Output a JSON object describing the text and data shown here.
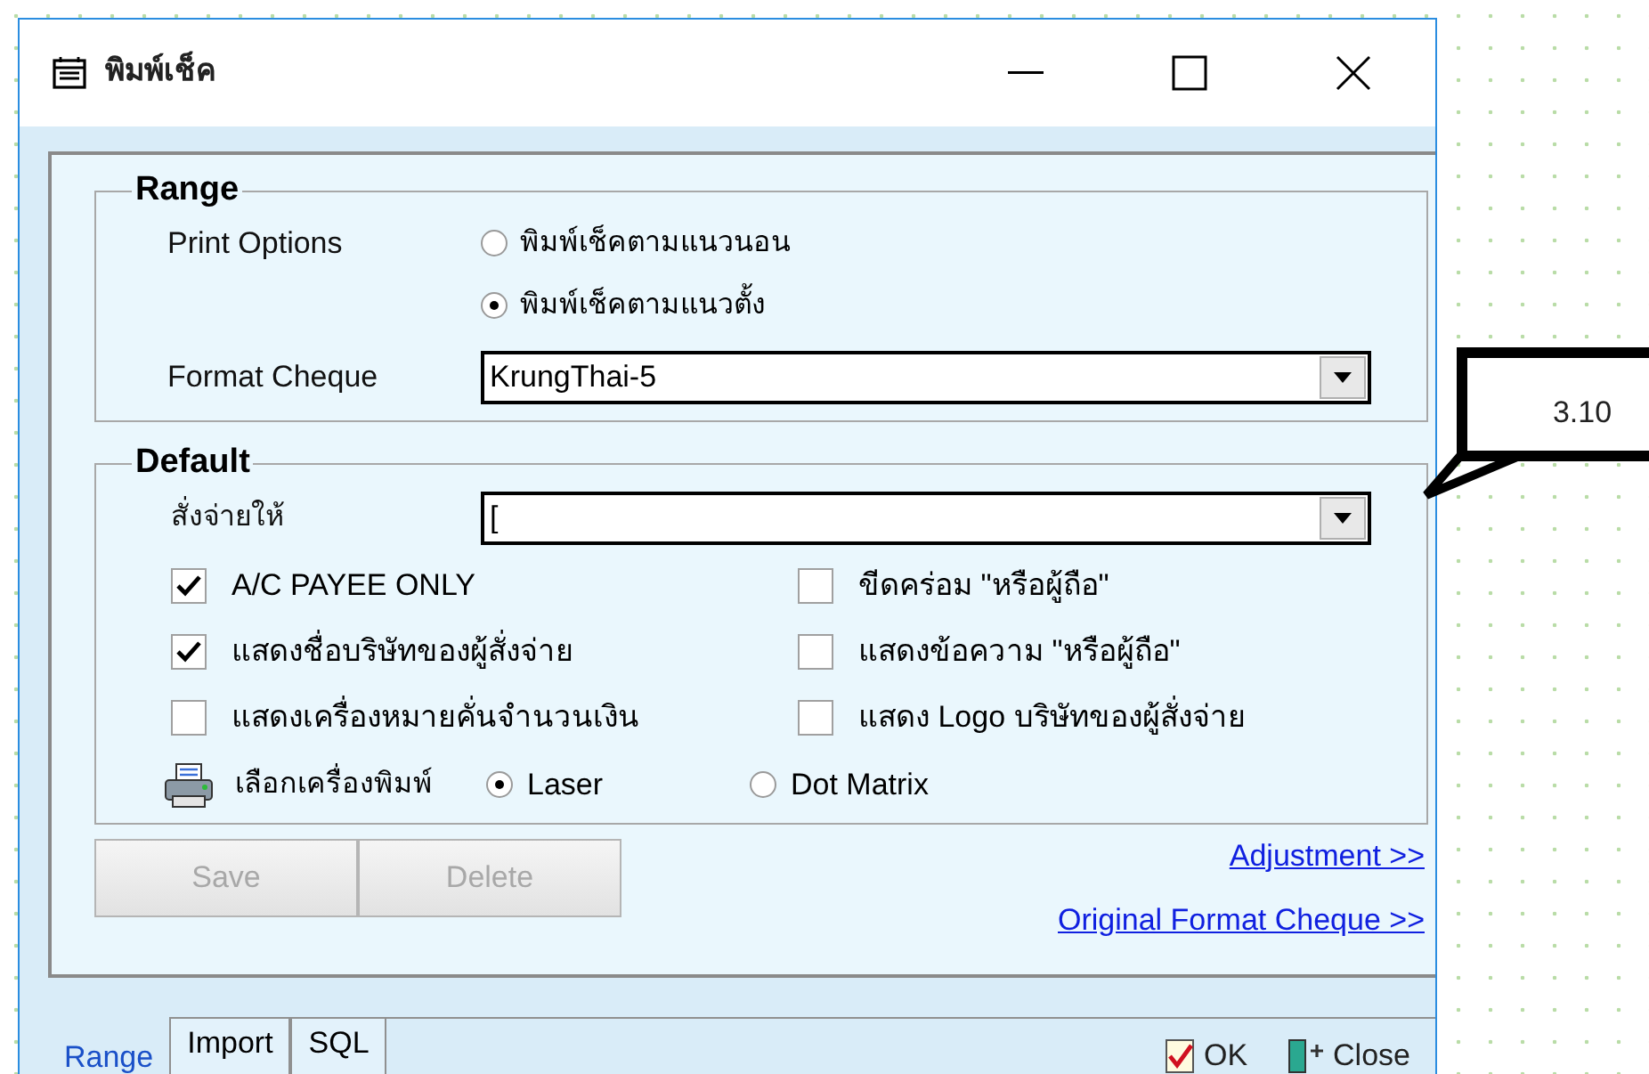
{
  "window": {
    "title": "พิมพ์เช็ค"
  },
  "range": {
    "title": "Range",
    "print_options_label": "Print Options",
    "print_options": [
      {
        "label": "พิมพ์เช็คตามแนวนอน",
        "selected": false
      },
      {
        "label": "พิมพ์เช็คตามแนวตั้ง",
        "selected": true
      }
    ],
    "format_label": "Format Cheque",
    "format_value": "KrungThai-5"
  },
  "default": {
    "title": "Default",
    "payee_label": "สั่งจ่ายให้",
    "payee_value": "[",
    "checkboxes": [
      {
        "label": "A/C PAYEE ONLY",
        "checked": true
      },
      {
        "label": "ขีดคร่อม \"หรือผู้ถือ\"",
        "checked": false
      },
      {
        "label": "แสดงชื่อบริษัทของผู้สั่งจ่าย",
        "checked": true
      },
      {
        "label": "แสดงข้อความ \"หรือผู้ถือ\"",
        "checked": false
      },
      {
        "label": "แสดงเครื่องหมายคั่นจำนวนเงิน",
        "checked": false
      },
      {
        "label": "แสดง Logo บริษัทของผู้สั่งจ่าย",
        "checked": false
      }
    ],
    "printer_label": "เลือกเครื่องพิมพ์",
    "printers": [
      {
        "label": "Laser",
        "selected": true
      },
      {
        "label": "Dot Matrix",
        "selected": false
      }
    ]
  },
  "buttons": [
    {
      "label": "Save",
      "disabled": true
    },
    {
      "label": "Delete",
      "disabled": true
    }
  ],
  "links": [
    "Adjustment >>",
    "Original Format Cheque >>"
  ],
  "tabs": [
    {
      "label": "Range",
      "selected": true
    },
    {
      "label": "Import",
      "selected": false
    },
    {
      "label": "SQL",
      "selected": false
    }
  ],
  "footer_buttons": [
    "OK",
    "Close"
  ],
  "callout": "3.10"
}
